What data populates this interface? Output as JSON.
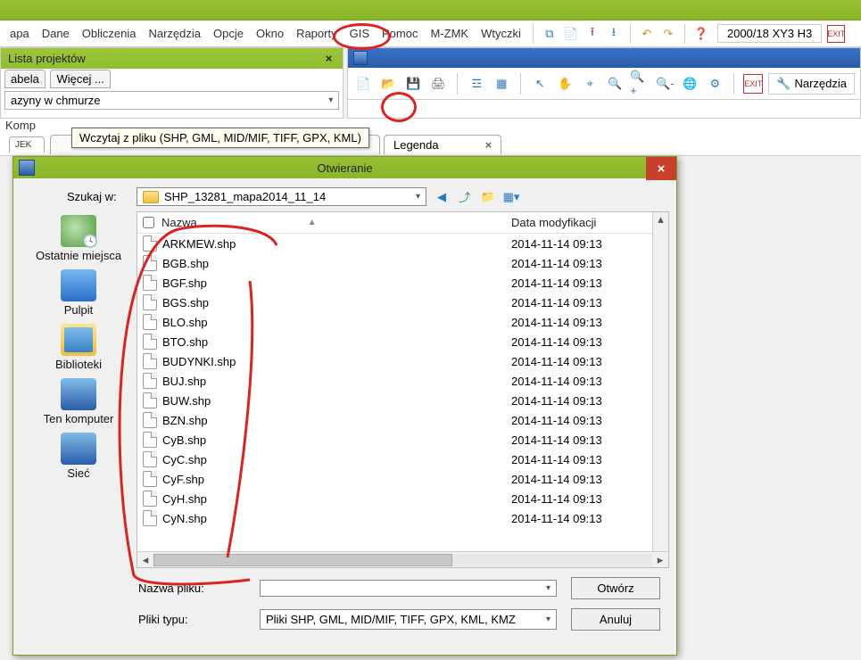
{
  "menubar": {
    "items": [
      "apa",
      "Dane",
      "Obliczenia",
      "Narzędzia",
      "Opcje",
      "Okno",
      "Raporty",
      "GIS",
      "Pomoc",
      "M-ZMK",
      "Wtyczki"
    ],
    "coord_label": "2000/18 XY3 H3"
  },
  "left_panel": {
    "title": "Lista projektów",
    "tabs": [
      "abela",
      "Więcej ..."
    ],
    "combo": "azyny w chmurze",
    "row": "Komp"
  },
  "right_toolbar": {
    "tools_label": "Narzędzia"
  },
  "tabstrip": {
    "first": "JEK",
    "legend_label": "Legenda"
  },
  "tooltip": "Wczytaj z pliku (SHP, GML, MID/MIF, TIFF, GPX, KML)",
  "dialog": {
    "title": "Otwieranie",
    "look_label": "Szukaj w:",
    "look_value": "SHP_13281_mapa2014_11_14",
    "places": [
      "Ostatnie miejsca",
      "Pulpit",
      "Biblioteki",
      "Ten komputer",
      "Sieć"
    ],
    "col_name": "Nazwa",
    "col_date": "Data modyfikacji",
    "files": [
      {
        "name": "ARKMEW.shp",
        "date": "2014-11-14 09:13"
      },
      {
        "name": "BGB.shp",
        "date": "2014-11-14 09:13"
      },
      {
        "name": "BGF.shp",
        "date": "2014-11-14 09:13"
      },
      {
        "name": "BGS.shp",
        "date": "2014-11-14 09:13"
      },
      {
        "name": "BLO.shp",
        "date": "2014-11-14 09:13"
      },
      {
        "name": "BTO.shp",
        "date": "2014-11-14 09:13"
      },
      {
        "name": "BUDYNKI.shp",
        "date": "2014-11-14 09:13"
      },
      {
        "name": "BUJ.shp",
        "date": "2014-11-14 09:13"
      },
      {
        "name": "BUW.shp",
        "date": "2014-11-14 09:13"
      },
      {
        "name": "BZN.shp",
        "date": "2014-11-14 09:13"
      },
      {
        "name": "CyB.shp",
        "date": "2014-11-14 09:13"
      },
      {
        "name": "CyC.shp",
        "date": "2014-11-14 09:13"
      },
      {
        "name": "CyF.shp",
        "date": "2014-11-14 09:13"
      },
      {
        "name": "CyH.shp",
        "date": "2014-11-14 09:13"
      },
      {
        "name": "CyN.shp",
        "date": "2014-11-14 09:13"
      }
    ],
    "filename_label": "Nazwa pliku:",
    "filename_value": "",
    "filetype_label": "Pliki typu:",
    "filetype_value": "Pliki SHP, GML, MID/MIF, TIFF, GPX, KML, KMZ",
    "open_btn": "Otwórz",
    "cancel_btn": "Anuluj"
  }
}
